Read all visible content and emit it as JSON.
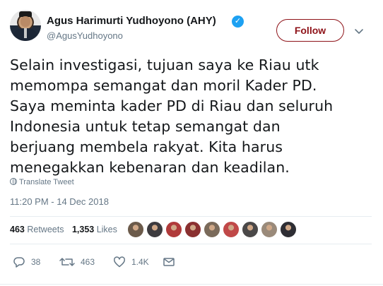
{
  "user": {
    "name": "Agus Harimurti Yudhoyono (AHY)",
    "handle": "@AgusYudhoyono",
    "verified_icon": "verified-badge-icon"
  },
  "follow_label": "Follow",
  "accent_color": "#8e1218",
  "tweet_lines": [
    "Selain investigasi, tujuan saya ke Riau utk",
    "memompa semangat dan moril Kader PD.",
    "Saya meminta kader PD di Riau dan seluruh",
    "Indonesia untuk tetap semangat dan",
    "berjuang membela rakyat. Kita harus",
    "menegakkan kebenaran dan keadilan."
  ],
  "translate_label": "Translate Tweet",
  "timestamp": "11:20 PM - 14 Dec 2018",
  "stats": {
    "retweets_count": "463",
    "retweets_label": "Retweets",
    "likes_count": "1,353",
    "likes_label": "Likes"
  },
  "likers": [
    "#6b5a4a",
    "#3d3b3f",
    "#b03a3a",
    "#8a3030",
    "#7a6a5a",
    "#c04848",
    "#4a4848",
    "#9a8a7a",
    "#2e2e34"
  ],
  "actions": {
    "reply_count": "38",
    "retweet_count": "463",
    "like_count": "1.4K"
  }
}
